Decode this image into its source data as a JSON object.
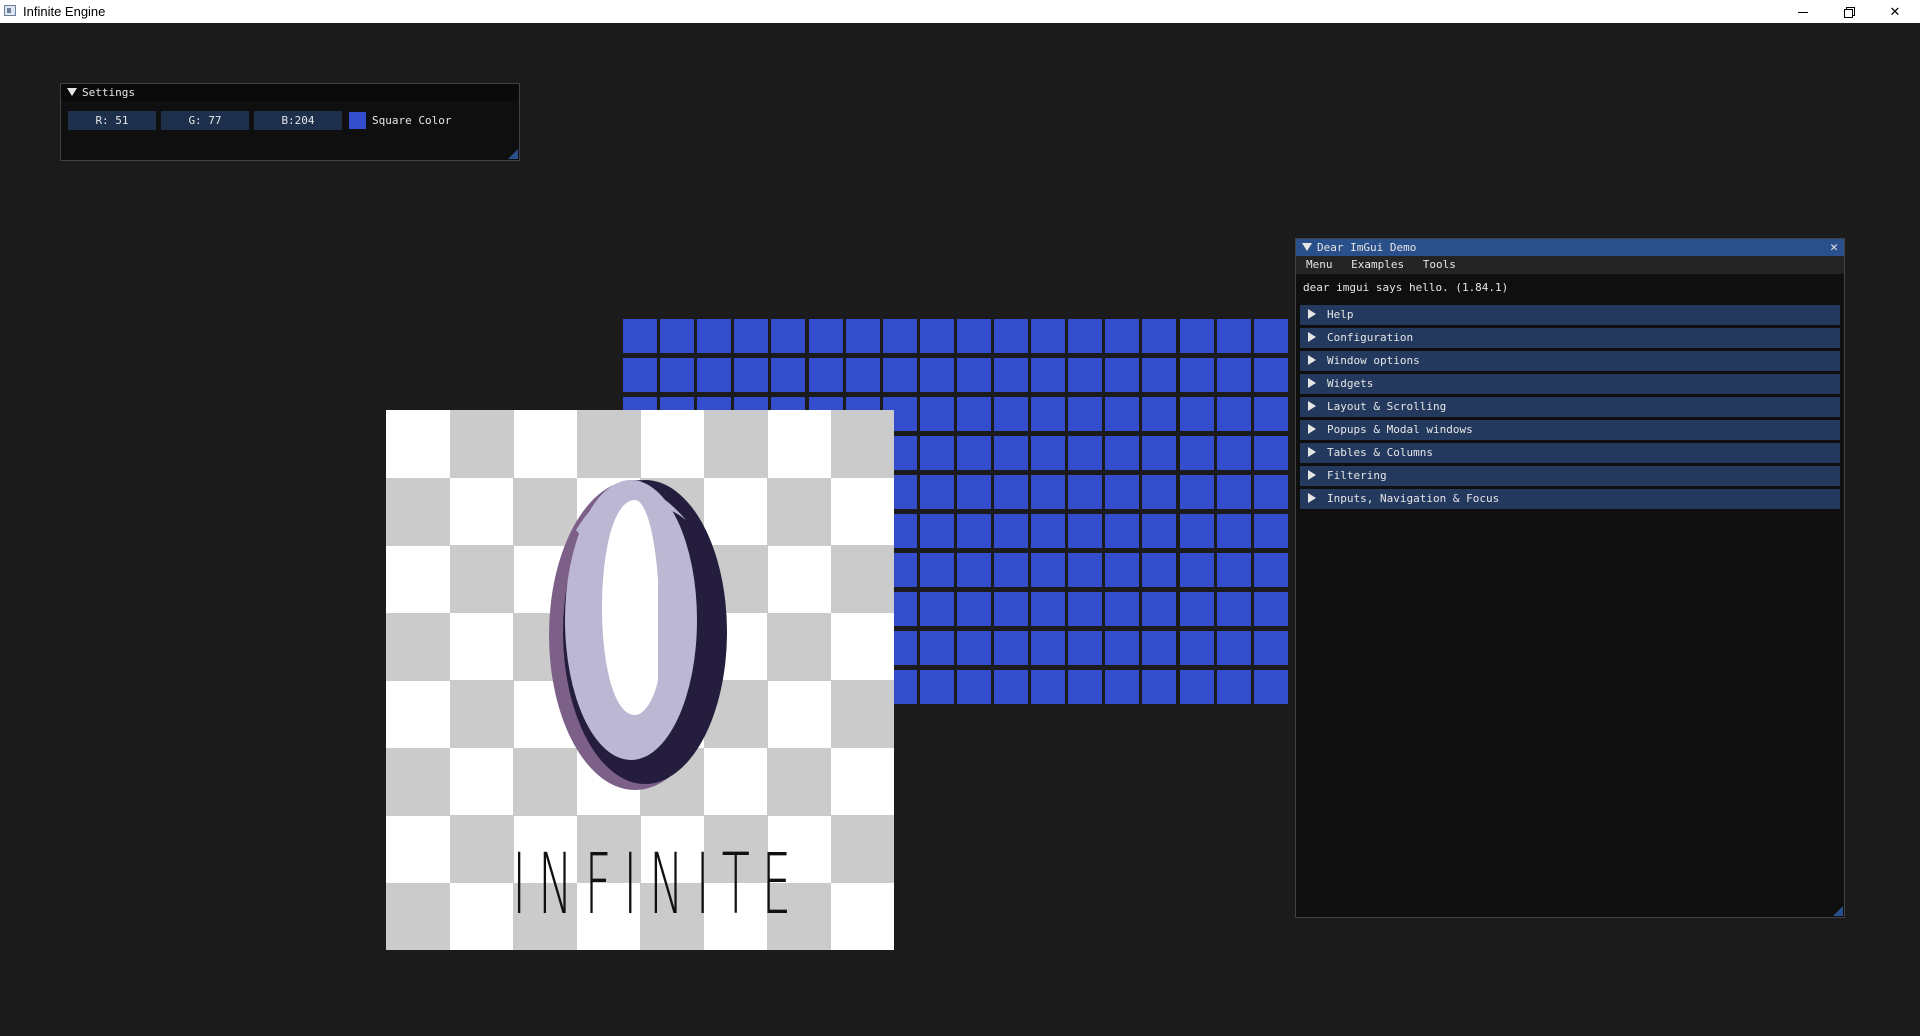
{
  "window": {
    "title": "Infinite Engine",
    "icon": "app-window-icon"
  },
  "settings": {
    "title": "Settings",
    "r_label": "R: 51",
    "g_label": "G: 77",
    "b_label": "B:204",
    "color_label": "Square Color",
    "square_color": "#334dcc"
  },
  "logo": {
    "text": "INFINITE"
  },
  "demo": {
    "title": "Dear ImGui Demo",
    "menus": [
      "Menu",
      "Examples",
      "Tools"
    ],
    "hello": "dear imgui says hello. (1.84.1)",
    "sections": [
      "Help",
      "Configuration",
      "Window options",
      "Widgets",
      "Layout & Scrolling",
      "Popups & Modal windows",
      "Tables & Columns",
      "Filtering",
      "Inputs, Navigation & Focus"
    ]
  },
  "colors": {
    "background": "#1b1b1b",
    "accent": "#29508a",
    "header": "#23395e",
    "square": "#334dcc"
  }
}
